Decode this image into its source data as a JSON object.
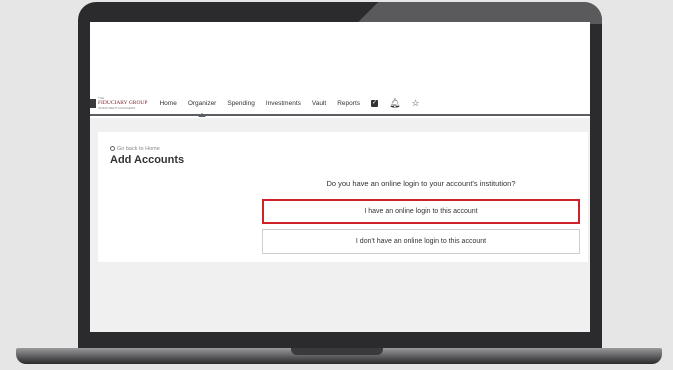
{
  "nav": {
    "logo_top": "THE",
    "logo_name": "FIDUCIARY GROUP",
    "logo_sub": "INVESTMENT MANAGERS",
    "items": [
      {
        "label": "Home",
        "active": false
      },
      {
        "label": "Organizer",
        "active": true
      },
      {
        "label": "Spending",
        "active": false
      },
      {
        "label": "Investments",
        "active": false
      },
      {
        "label": "Vault",
        "active": false
      },
      {
        "label": "Reports",
        "active": false
      }
    ],
    "icons": [
      "checkbox-icon",
      "bell-icon",
      "star-icon"
    ]
  },
  "page": {
    "back_link": "Go back to Home",
    "title": "Add Accounts",
    "question": "Do you have an online login to your account's institution?",
    "option_yes": "I have an online login to this account",
    "option_no": "I don't have an online login to this account"
  },
  "colors": {
    "highlight": "#d0202a",
    "nav_rule": "#5b5e62",
    "laptop": "#2b2b2d"
  }
}
